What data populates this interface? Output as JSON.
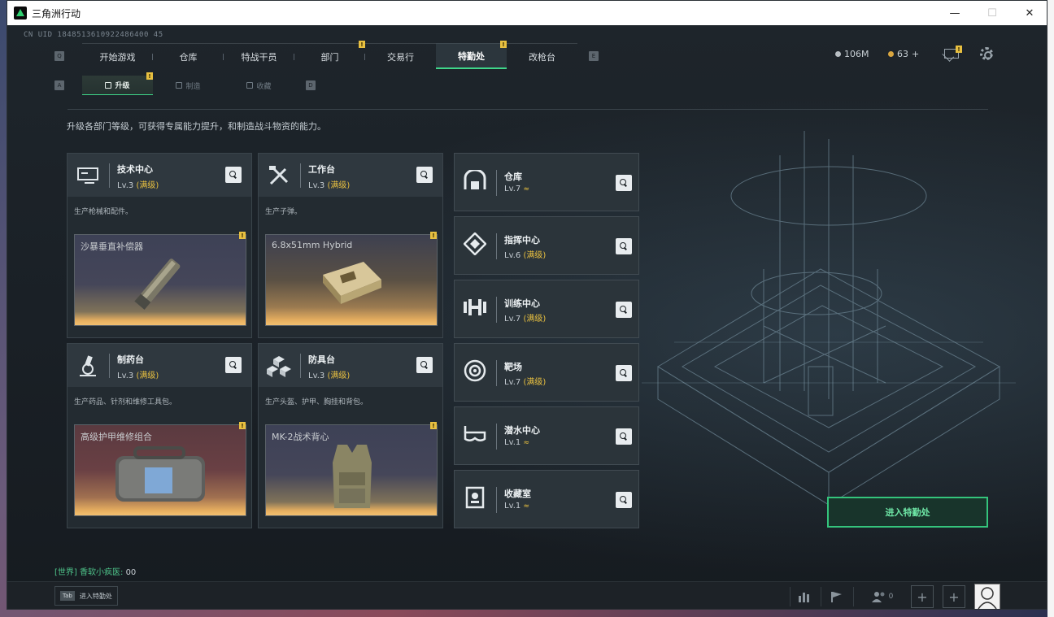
{
  "window": {
    "title": "三角洲行动",
    "minimize": "—",
    "maximize": "☐",
    "close": "✕"
  },
  "uid": "CN UID 1848513610922486400 45",
  "nav": {
    "left_key": "Q",
    "right_key": "E",
    "tabs": [
      {
        "label": "开始游戏",
        "badge": ""
      },
      {
        "label": "仓库",
        "badge": ""
      },
      {
        "label": "特战干员",
        "badge": ""
      },
      {
        "label": "部门",
        "badge": "!"
      },
      {
        "label": "交易行",
        "badge": ""
      },
      {
        "label": "特勤处",
        "badge": "!",
        "active": true
      },
      {
        "label": "改枪台",
        "badge": ""
      }
    ]
  },
  "currency": {
    "silver": "106M",
    "gold": "63",
    "gold_plus": "+"
  },
  "mail_badge": "!",
  "subnav": {
    "left_key": "A",
    "right_key": "D",
    "tabs": [
      {
        "label": "升级",
        "badge": "!",
        "active": true
      },
      {
        "label": "制造"
      },
      {
        "label": "收藏"
      }
    ]
  },
  "description": "升级各部门等级，可获得专属能力提升，和制造战斗物资的能力。",
  "cards": [
    {
      "name": "技术中心",
      "lv": "Lv.3",
      "max": "(满级)",
      "sub": "生产枪械和配件。",
      "item": "沙暴垂直补偿器",
      "badge": "!"
    },
    {
      "name": "工作台",
      "lv": "Lv.3",
      "max": "(满级)",
      "sub": "生产子弹。",
      "item": "6.8x51mm Hybrid",
      "badge": "!"
    },
    {
      "name": "制药台",
      "lv": "Lv.3",
      "max": "(满级)",
      "sub": "生产药品、针剂和维修工具包。",
      "item": "高级护甲维修组合",
      "badge": "!"
    },
    {
      "name": "防具台",
      "lv": "Lv.3",
      "max": "(满级)",
      "sub": "生产头盔、护甲、胸挂和背包。",
      "item": "MK-2战术背心",
      "badge": "!"
    }
  ],
  "small_cards": [
    {
      "name": "仓库",
      "lv": "Lv.7",
      "max": "",
      "up": "≈"
    },
    {
      "name": "指挥中心",
      "lv": "Lv.6",
      "max": "(满级)",
      "up": ""
    },
    {
      "name": "训练中心",
      "lv": "Lv.7",
      "max": "(满级)",
      "up": ""
    },
    {
      "name": "靶场",
      "lv": "Lv.7",
      "max": "(满级)",
      "up": ""
    },
    {
      "name": "潜水中心",
      "lv": "Lv.1",
      "max": "",
      "up": "≈"
    },
    {
      "name": "收藏室",
      "lv": "Lv.1",
      "max": "",
      "up": "≈"
    }
  ],
  "enter_button": "进入特勤处",
  "chat": {
    "channel": "[世界]",
    "user": "香软小疯医:",
    "message": "00"
  },
  "bottom": {
    "tab_key": "Tab",
    "tab_label": "进入特勤处",
    "friends_count": "0"
  },
  "colors": {
    "accent": "#3fd68a",
    "gold": "#e8c040",
    "bg": "#1a1f24"
  }
}
